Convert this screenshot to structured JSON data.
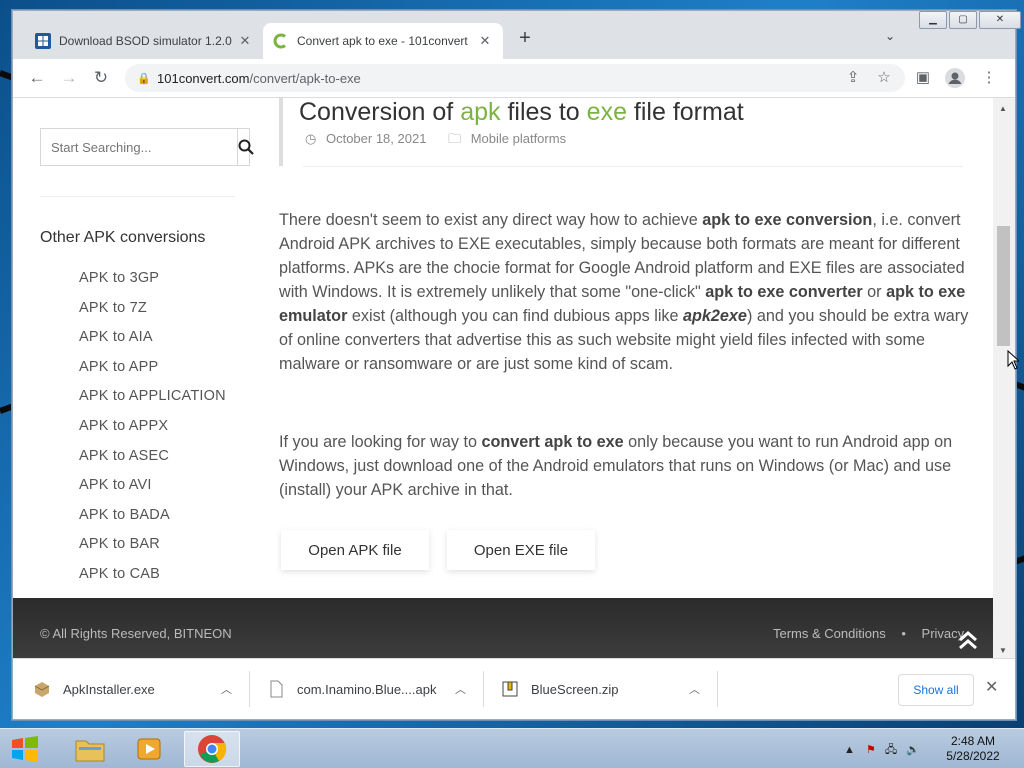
{
  "browser": {
    "tabs": [
      {
        "title": "Download BSOD simulator 1.2.0",
        "active": false
      },
      {
        "title": "Convert apk to exe - 101convert",
        "active": true
      }
    ],
    "new_tab_label": "+",
    "url_host": "101convert.com",
    "url_path": "/convert/apk-to-exe"
  },
  "sidebar": {
    "search_placeholder": "Start Searching...",
    "heading": "Other APK conversions",
    "items": [
      "APK to 3GP",
      "APK to 7Z",
      "APK to AIA",
      "APK to APP",
      "APK to APPLICATION",
      "APK to APPX",
      "APK to ASEC",
      "APK to AVI",
      "APK to BADA",
      "APK to BAR",
      "APK to CAB"
    ]
  },
  "article": {
    "title_pre": "Conversion of ",
    "title_hl1": "apk",
    "title_mid": " files to ",
    "title_hl2": "exe",
    "title_post": " file format",
    "date": "October 18, 2021",
    "category": "Mobile platforms",
    "accent_color": "#7cb342",
    "para1": {
      "t1": "There doesn't seem to exist any direct way how to achieve ",
      "b1": "apk to exe conversion",
      "t2": ", i.e. convert Android APK archives to EXE executables, simply because both formats are meant for different platforms. APKs are the chocie format for Google Android platform and EXE files are associated with Windows. It is extremely unlikely that some \"one-click\" ",
      "b2": "apk to exe converter",
      "t3": " or ",
      "b3": "apk to exe emulator",
      "t4": " exist (although you can find dubious apps like ",
      "bi": "apk2exe",
      "t5": ") and you should be extra wary of online converters that advertise this as such website might yield files infected with some malware or ransomware or are just some kind of scam."
    },
    "para2": {
      "t1": "If you are looking for way to ",
      "b1": "convert apk to exe",
      "t2": " only because you want to run Android app on Windows, just download one of the Android emulators that runs on Windows (or Mac) and use (install) your APK archive in that."
    },
    "btn_open_apk": "Open APK file",
    "btn_open_exe": "Open EXE file"
  },
  "footer": {
    "copyright": "© All Rights Reserved, BITNEON",
    "terms": "Terms & Conditions",
    "bullet": "•",
    "privacy": "Privacy"
  },
  "downloads": {
    "items": [
      {
        "name": "ApkInstaller.exe"
      },
      {
        "name": "com.Inamino.Blue....apk"
      },
      {
        "name": "BlueScreen.zip"
      }
    ],
    "show_all": "Show all"
  },
  "taskbar": {
    "time": "2:48 AM",
    "date": "5/28/2022"
  }
}
